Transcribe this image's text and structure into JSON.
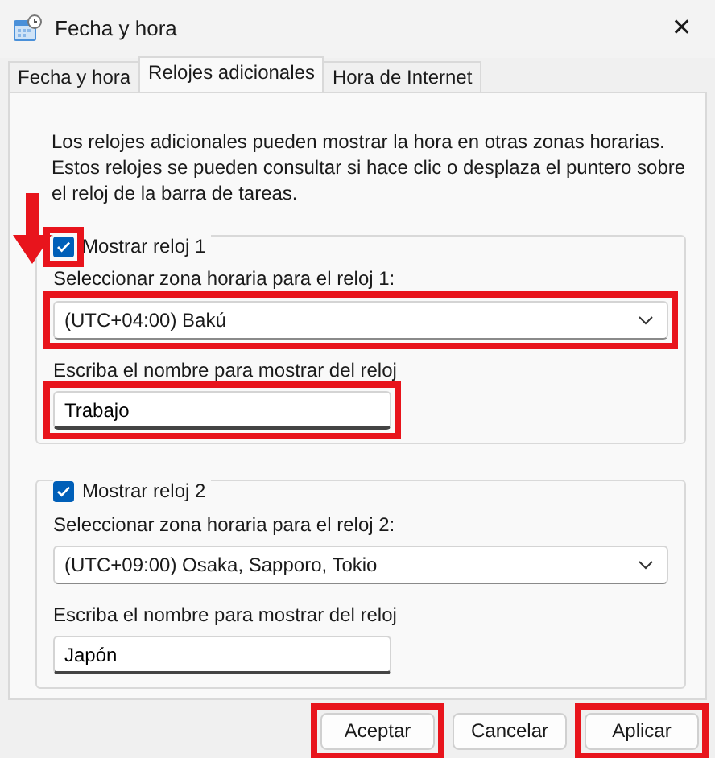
{
  "window": {
    "title": "Fecha y hora",
    "close": "✕"
  },
  "tabs": [
    {
      "label": "Fecha y hora",
      "selected": false
    },
    {
      "label": "Relojes adicionales",
      "selected": true
    },
    {
      "label": "Hora de Internet",
      "selected": false
    }
  ],
  "description": "Los relojes adicionales pueden mostrar la hora en otras zonas horarias. Estos relojes se pueden consultar si hace clic o desplaza el puntero sobre el reloj de la barra de tareas.",
  "clocks": [
    {
      "label": "Mostrar reloj 1",
      "checked": true,
      "checkbox_highlighted": true,
      "arrow": true,
      "zone_label": "Seleccionar zona horaria para el reloj 1:",
      "zone": "(UTC+04:00) Bakú",
      "zone_highlighted": true,
      "name_label": "Escriba el nombre para mostrar del reloj",
      "name": "Trabajo",
      "name_highlighted": true
    },
    {
      "label": "Mostrar reloj 2",
      "checked": true,
      "checkbox_highlighted": false,
      "arrow": false,
      "zone_label": "Seleccionar zona horaria para el reloj 2:",
      "zone": "(UTC+09:00) Osaka, Sapporo, Tokio",
      "zone_highlighted": false,
      "name_label": "Escriba el nombre para mostrar del reloj",
      "name": "Japón",
      "name_highlighted": false
    }
  ],
  "buttons": [
    {
      "label": "Aceptar",
      "highlighted": true
    },
    {
      "label": "Cancelar",
      "highlighted": false
    },
    {
      "label": "Aplicar",
      "highlighted": true
    }
  ]
}
